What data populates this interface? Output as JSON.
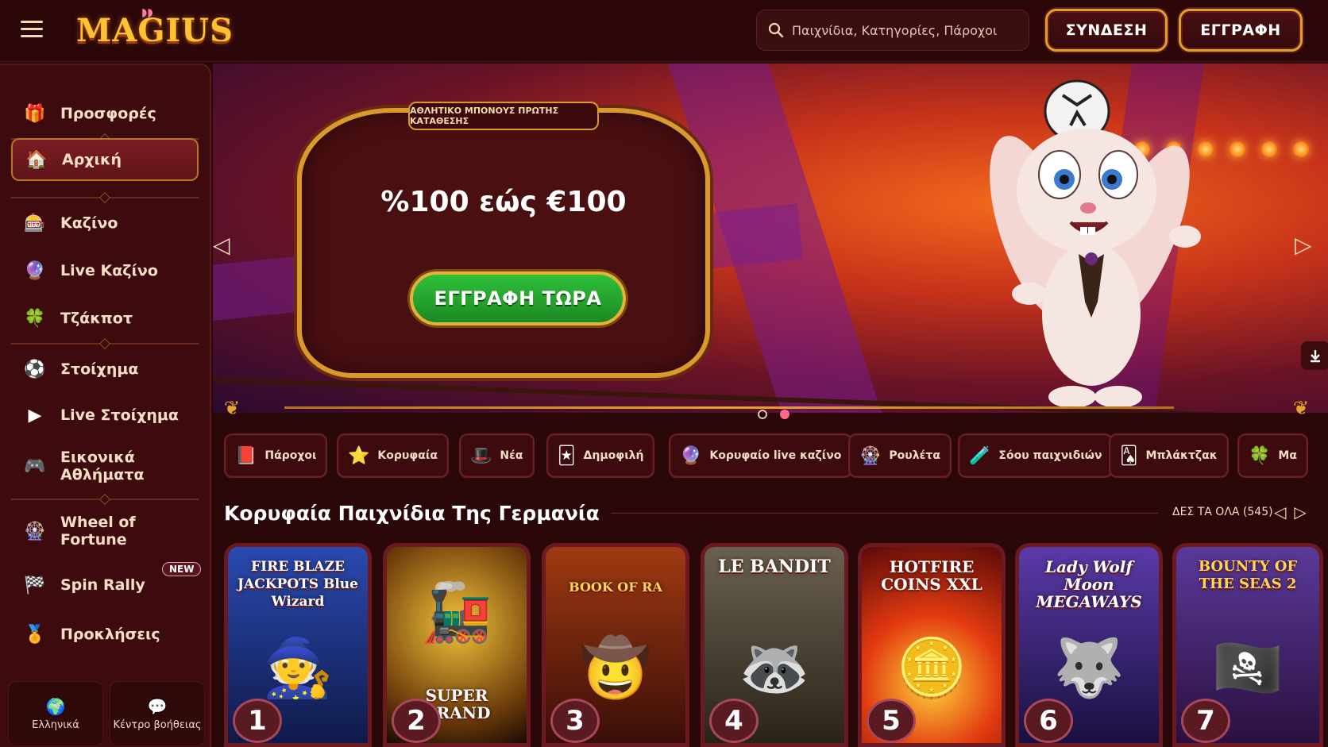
{
  "header": {
    "logo": "MAGIUS",
    "search_placeholder": "Παιχνίδια, Κατηγορίες, Πάροχοι",
    "login_label": "ΣΥΝΔΕΣΗ",
    "register_label": "ΕΓΓΡΑΦΗ"
  },
  "sidebar": {
    "items": [
      {
        "label": "Προσφορές",
        "icon": "gift-icon"
      },
      {
        "label": "Αρχική",
        "icon": "home-icon"
      },
      {
        "label": "Καζίνο",
        "icon": "casino-icon"
      },
      {
        "label": "Live Καζίνο",
        "icon": "live-casino-icon"
      },
      {
        "label": "Τζάκποτ",
        "icon": "jackpot-icon"
      },
      {
        "label": "Στοίχημα",
        "icon": "betting-icon"
      },
      {
        "label": "Live Στοίχημα",
        "icon": "live-betting-icon"
      },
      {
        "label": "Εικονικά Αθλήματα",
        "icon": "gamepad-icon"
      },
      {
        "label": "Wheel of Fortune",
        "icon": "wheel-icon"
      },
      {
        "label": "Spin Rally",
        "icon": "flag-icon"
      },
      {
        "label": "Προκλήσεις",
        "icon": "medal-icon"
      }
    ],
    "new_badge": "NEW",
    "language_label": "Ελληνικά",
    "help_label": "Κέντρο βοήθειας"
  },
  "banner": {
    "tag": "ΑΘΛΗΤΙΚΟ ΜΠΟΝΟΥΣ ΠΡΩΤΗΣ ΚΑΤΑΘΕΣΗΣ",
    "amount": "%100 εώς €100",
    "cta": "ΕΓΓΡΑΦΗ ΤΩΡΑ",
    "slides_total": 2,
    "active_slide": 2
  },
  "categories": [
    {
      "label": "Πάροχοι",
      "icon": "book-icon"
    },
    {
      "label": "Κορυφαία",
      "icon": "top-hat-star-icon"
    },
    {
      "label": "Νέα",
      "icon": "magic-hat-icon"
    },
    {
      "label": "Δημοφιλή",
      "icon": "jester-icon"
    },
    {
      "label": "Κορυφαίο live καζίνο",
      "icon": "live-casino-icon"
    },
    {
      "label": "Ρουλέτα",
      "icon": "roulette-icon"
    },
    {
      "label": "Σόου παιχνιδιών",
      "icon": "potion-icon"
    },
    {
      "label": "Μπλάκτζακ",
      "icon": "cards-icon"
    },
    {
      "label": "Μα",
      "icon": "jackpot-icon"
    }
  ],
  "section": {
    "title": "Κορυφαία Παιχνίδια Της Γερμανία",
    "see_all": "ΔΕΣ ΤΑ ΟΛΑ (545)"
  },
  "games": [
    {
      "rank": "1",
      "title": "FIRE BLAZE JACKPOTS Blue Wizard",
      "color": "#1f3f9a"
    },
    {
      "rank": "2",
      "title": "SUPER GRAND",
      "color": "#6b4a10"
    },
    {
      "rank": "3",
      "title": "BOOK OF RA",
      "color": "#8a2a10"
    },
    {
      "rank": "4",
      "title": "LE BANDIT",
      "color": "#5a5040"
    },
    {
      "rank": "5",
      "title": "HOTFIRE COINS XXL",
      "color": "#b0200f"
    },
    {
      "rank": "6",
      "title": "Lady Wolf Moon MEGAWAYS",
      "color": "#3a2a7a"
    },
    {
      "rank": "7",
      "title": "BOUNTY OF THE SEAS 2",
      "color": "#3a2a6a"
    }
  ],
  "colors": {
    "background": "#2a0708",
    "sidebar": "#3d0b0e",
    "gold": "#e0a128",
    "cta_green": "#1c8a22"
  }
}
